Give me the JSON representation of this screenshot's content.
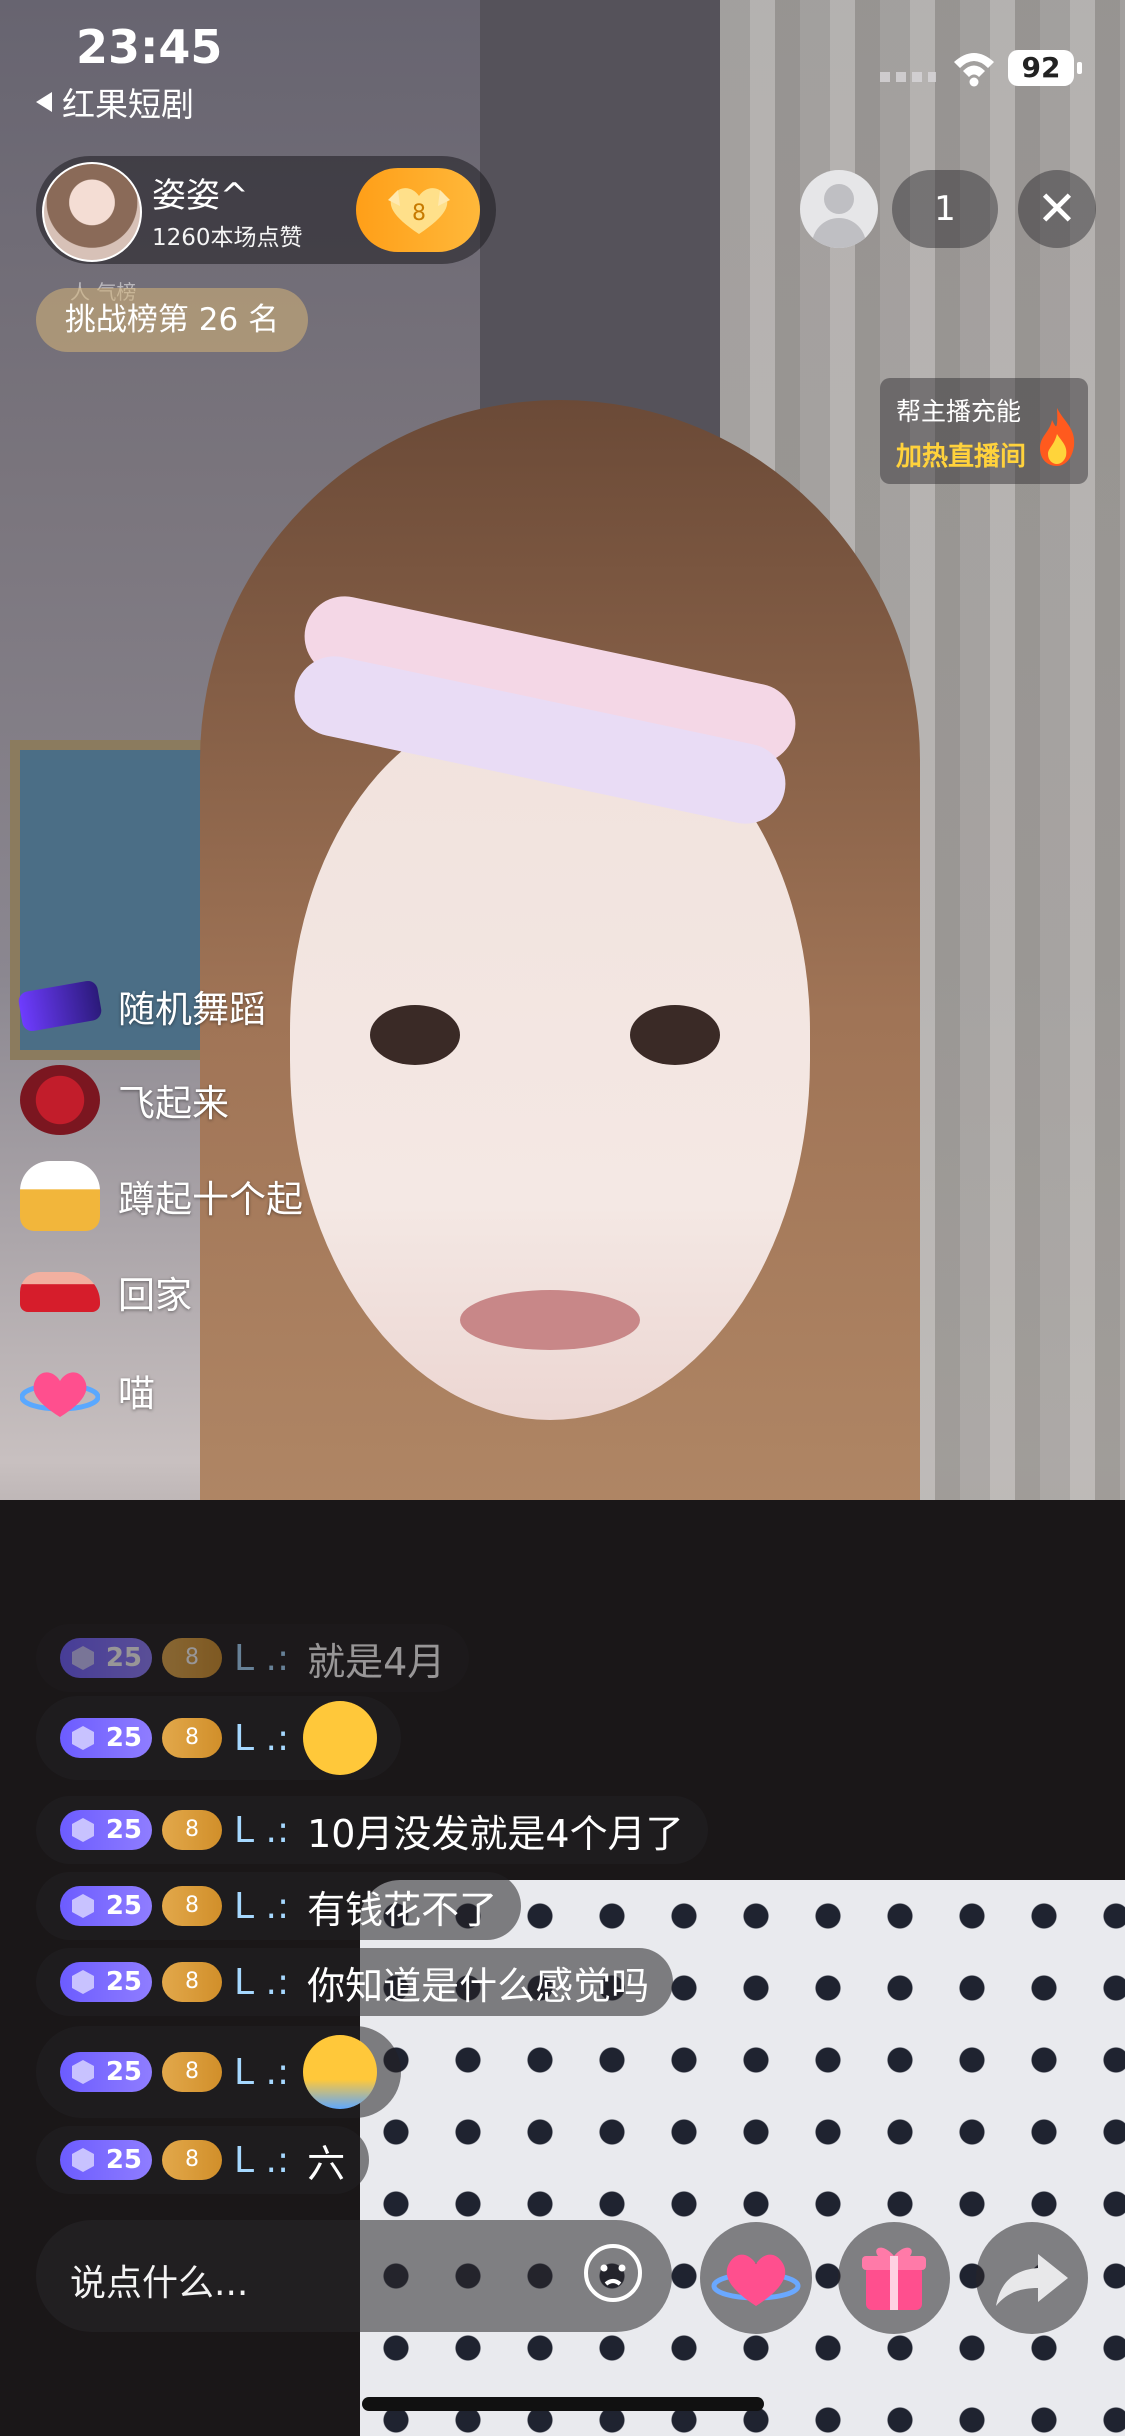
{
  "status_bar": {
    "time": "23:45",
    "back_app": "红果短剧",
    "battery": "92"
  },
  "host": {
    "name": "姿姿^",
    "likes": "1260本场点赞",
    "badge_level": "8",
    "rank_small": "人 气榜",
    "rank": "挑战榜第 26 名"
  },
  "viewers": {
    "count": "1"
  },
  "charge_panel": {
    "line1": "帮主播充能",
    "line2": "加热直播间"
  },
  "gift_menu": [
    {
      "label": "随机舞蹈",
      "icon": "sunglasses-icon"
    },
    {
      "label": "飞起来",
      "icon": "rose-bouquet-icon"
    },
    {
      "label": "蹲起十个起",
      "icon": "beer-mug-icon"
    },
    {
      "label": "回家",
      "icon": "sports-car-icon"
    },
    {
      "label": "喵",
      "icon": "heart-planet-icon"
    }
  ],
  "chat": [
    {
      "level": "25",
      "fan": "8",
      "user": "L .:",
      "msg": "就是4月",
      "faded": true
    },
    {
      "level": "25",
      "fan": "8",
      "user": "L .:",
      "msg": "",
      "emoji": "rolling-eyes-emoji"
    },
    {
      "level": "25",
      "fan": "8",
      "user": "L .:",
      "msg": "10月没发就是4个月了"
    },
    {
      "level": "25",
      "fan": "8",
      "user": "L .:",
      "msg": "有钱花不了"
    },
    {
      "level": "25",
      "fan": "8",
      "user": "L .:",
      "msg": "你知道是什么感觉吗"
    },
    {
      "level": "25",
      "fan": "8",
      "user": "L .:",
      "msg": "",
      "emoji": "crying-emoji"
    },
    {
      "level": "25",
      "fan": "8",
      "user": "L .:",
      "msg": "六"
    }
  ],
  "bottom_bar": {
    "placeholder": "说点什么..."
  },
  "colors": {
    "accent_orange": "#ffa81f",
    "charge_yellow": "#ffd23c",
    "level_purple": "#7a6bff",
    "username_blue": "#a6d8ff"
  }
}
